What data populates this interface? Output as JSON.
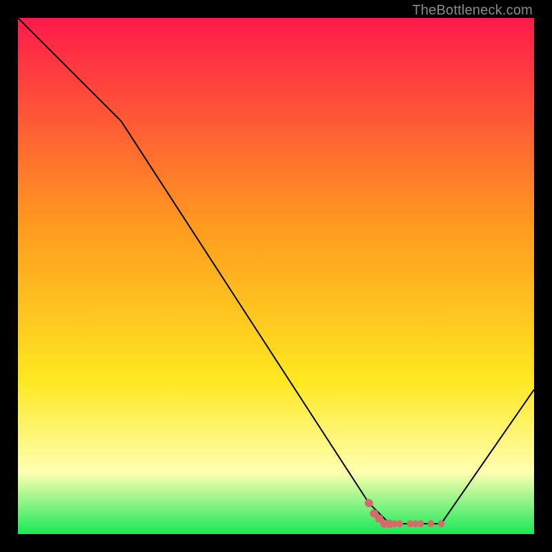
{
  "watermark": "TheBottleneck.com",
  "gradient": {
    "top": "#ff1a4b",
    "mid1": "#ff9a1f",
    "mid2": "#ffe71f",
    "mid3": "#ffffb0",
    "bot": "#18e858"
  },
  "chart_data": {
    "type": "line",
    "title": "",
    "xlabel": "",
    "ylabel": "",
    "xlim": [
      0,
      100
    ],
    "ylim": [
      0,
      100
    ],
    "series": [
      {
        "name": "bottleneck-curve",
        "x": [
          0,
          20,
          68,
          72,
          78,
          82,
          100
        ],
        "values": [
          100,
          80,
          6,
          2,
          2,
          2,
          28
        ]
      }
    ],
    "markers": {
      "name": "highlight-dots",
      "color": "#d46a6a",
      "points": [
        {
          "x": 68,
          "y": 6
        },
        {
          "x": 69,
          "y": 4
        },
        {
          "x": 70,
          "y": 3
        },
        {
          "x": 71,
          "y": 2
        },
        {
          "x": 72,
          "y": 2
        },
        {
          "x": 73,
          "y": 2
        },
        {
          "x": 74,
          "y": 2
        },
        {
          "x": 76,
          "y": 2
        },
        {
          "x": 77,
          "y": 2
        },
        {
          "x": 78,
          "y": 2
        },
        {
          "x": 80,
          "y": 2
        },
        {
          "x": 82,
          "y": 2
        }
      ]
    }
  }
}
